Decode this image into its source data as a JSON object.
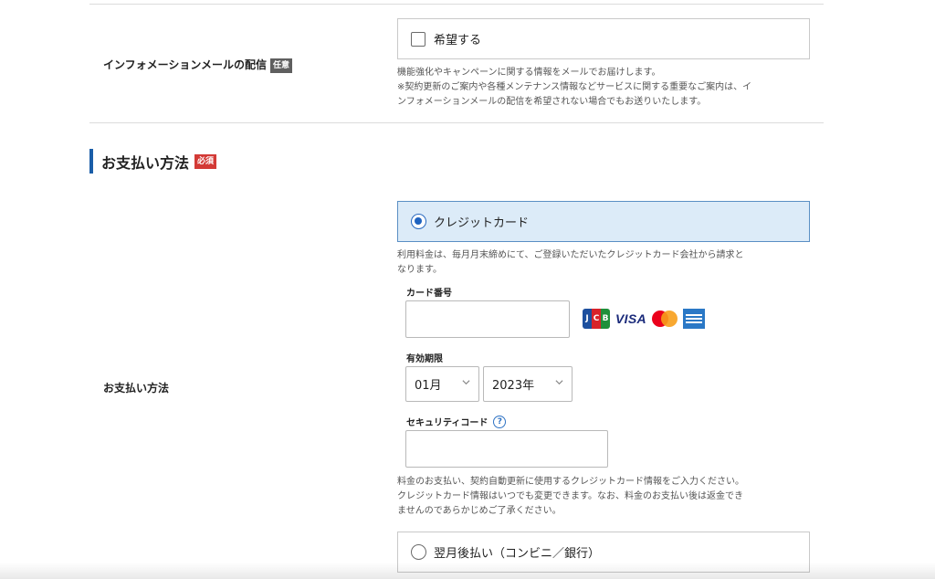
{
  "info_mail": {
    "label": "インフォメーションメールの配信",
    "badge": "任意",
    "checkbox_label": "希望する",
    "checked": false,
    "note_lines": [
      "機能強化やキャンペーンに関する情報をメールでお届けします。",
      "※契約更新のご案内や各種メンテナンス情報などサービスに関する重要なご案内は、イ",
      "ンフォメーションメールの配信を希望されない場合でもお送りいたします。"
    ]
  },
  "payment_section": {
    "title": "お支払い方法",
    "badge": "必須",
    "accent_color": "#1a5ea8"
  },
  "payment": {
    "row_label": "お支払い方法",
    "credit_option_label": "クレジットカード",
    "credit_selected": true,
    "credit_note_lines": [
      "利用料金は、毎月月末締めにて、ご登録いただいたクレジットカード会社から請求と",
      "なります。"
    ],
    "card_number": {
      "label": "カード番号",
      "value": ""
    },
    "card_brands": [
      "jcb-icon",
      "visa-icon",
      "mastercard-icon",
      "amex-icon"
    ],
    "visa_text": "VISA",
    "jcb_letters": [
      "J",
      "C",
      "B"
    ],
    "expiry": {
      "label": "有効期限",
      "month": "01月",
      "year": "2023年"
    },
    "security_code": {
      "label": "セキュリティコード",
      "help_glyph": "?",
      "value": ""
    },
    "credit_footer_lines": [
      "料金のお支払い、契約自動更新に使用するクレジットカード情報をご入力ください。",
      "クレジットカード情報はいつでも変更できます。なお、料金のお支払い後は返金でき",
      "ませんのであらかじめご了承ください。"
    ],
    "deferred_option_label": "翌月後払い（コンビニ／銀行）",
    "deferred_selected": false
  },
  "colors": {
    "required_badge": "#d33a36",
    "optional_badge": "#5f5f5f",
    "selected_bg": "#dcebf8",
    "radio_on": "#1f63c0"
  }
}
